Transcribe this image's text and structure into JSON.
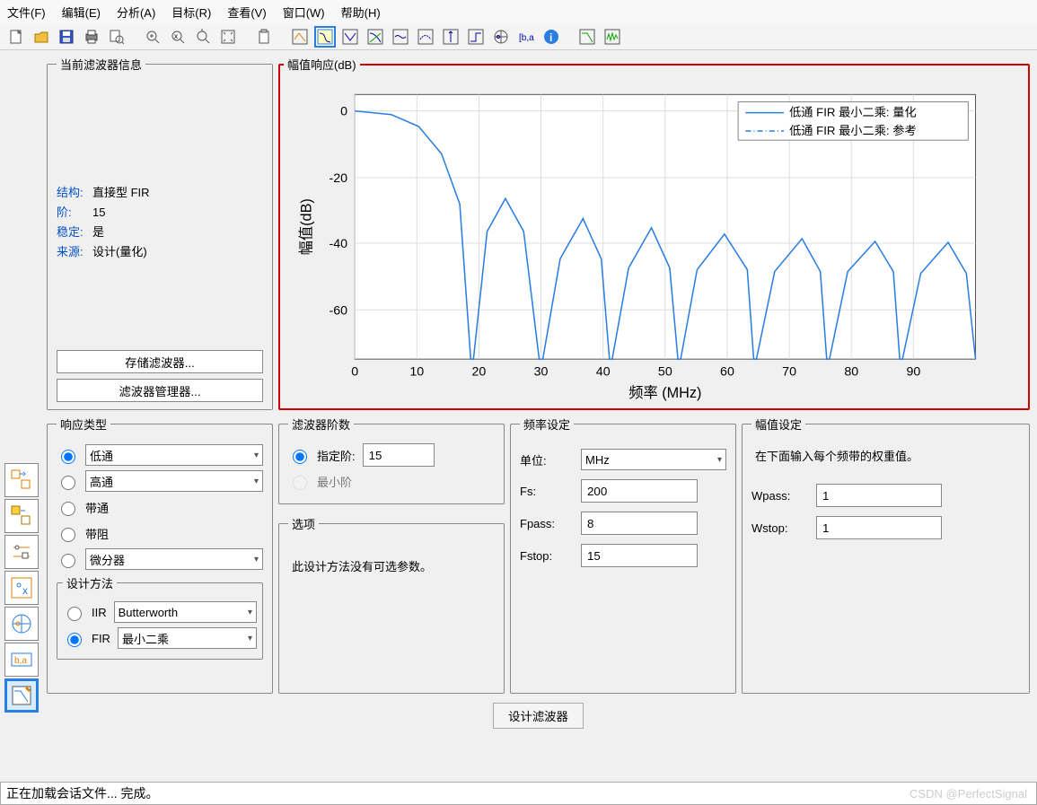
{
  "menu": [
    "文件(F)",
    "编辑(E)",
    "分析(A)",
    "目标(R)",
    "查看(V)",
    "窗口(W)",
    "帮助(H)"
  ],
  "info": {
    "title": "当前滤波器信息",
    "rows": [
      {
        "k": "结构:",
        "v": "直接型 FIR"
      },
      {
        "k": "阶:",
        "v": "15"
      },
      {
        "k": "稳定:",
        "v": "是"
      },
      {
        "k": "来源:",
        "v": "设计(量化)"
      }
    ],
    "btn1": "存储滤波器...",
    "btn2": "滤波器管理器..."
  },
  "chart": {
    "title": "幅值响应(dB)",
    "xlabel": "频率 (MHz)",
    "ylabel": "幅值(dB)",
    "legend": [
      "低通 FIR 最小二乘: 量化",
      "低通 FIR 最小二乘: 参考"
    ]
  },
  "chart_data": {
    "type": "line",
    "xlabel": "频率 (MHz)",
    "ylabel": "幅值(dB)",
    "xlim": [
      0,
      100
    ],
    "ylim": [
      -75,
      5
    ],
    "xticks": [
      0,
      10,
      20,
      30,
      40,
      50,
      60,
      70,
      80,
      90
    ],
    "yticks": [
      0,
      -20,
      -40,
      -60
    ],
    "series": [
      {
        "name": "低通 FIR 最小二乘: 量化",
        "style": "solid",
        "color": "#2a7de1"
      },
      {
        "name": "低通 FIR 最小二乘: 参考",
        "style": "dash-dot",
        "color": "#2a7de1"
      }
    ],
    "nulls_freq_MHz": [
      19,
      30,
      41,
      52,
      64,
      76,
      88,
      100
    ],
    "lobe_peaks_dB": [
      -26,
      -32,
      -35,
      -37,
      -38,
      -39,
      -39,
      -40
    ],
    "passband_dB": 0
  },
  "resp": {
    "title": "响应类型",
    "opts": [
      "低通",
      "高通",
      "带通",
      "带阻",
      "微分器"
    ],
    "method_title": "设计方法",
    "iir": "IIR",
    "iir_sel": "Butterworth",
    "fir": "FIR",
    "fir_sel": "最小二乘"
  },
  "order": {
    "title": "滤波器阶数",
    "specify": "指定阶:",
    "specify_val": "15",
    "min": "最小阶",
    "opts_title": "选项",
    "opts_msg": "此设计方法没有可选参数。"
  },
  "freq": {
    "title": "频率设定",
    "unit_lbl": "单位:",
    "unit": "MHz",
    "rows": [
      {
        "l": "Fs:",
        "v": "200"
      },
      {
        "l": "Fpass:",
        "v": "8"
      },
      {
        "l": "Fstop:",
        "v": "15"
      }
    ]
  },
  "mag": {
    "title": "幅值设定",
    "msg": "在下面输入每个频带的权重值。",
    "rows": [
      {
        "l": "Wpass:",
        "v": "1"
      },
      {
        "l": "Wstop:",
        "v": "1"
      }
    ]
  },
  "design_btn": "设计滤波器",
  "status": "正在加载会话文件... 完成。",
  "watermark": "CSDN @PerfectSignal"
}
